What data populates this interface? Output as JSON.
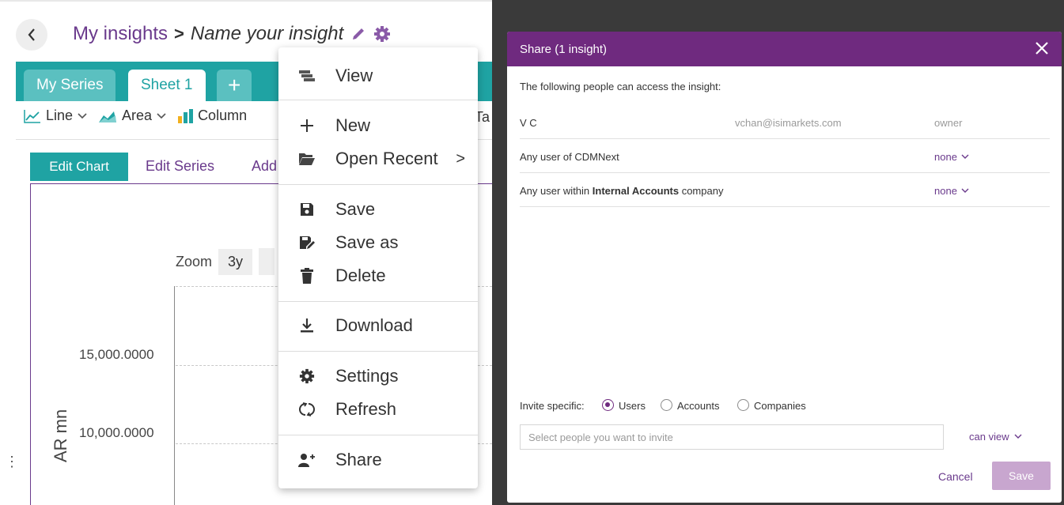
{
  "header": {
    "breadcrumb_root": "My insights",
    "breadcrumb_sep": ">",
    "insight_name": "Name your insight"
  },
  "tabs": [
    {
      "label": "My Series"
    },
    {
      "label": "Sheet 1"
    },
    {
      "label": "+"
    }
  ],
  "chart_types": [
    {
      "label": "Line",
      "icon": "line-chart-icon"
    },
    {
      "label": "Area",
      "icon": "area-chart-icon"
    },
    {
      "label": "Column",
      "icon": "column-chart-icon"
    },
    {
      "label": "Ta"
    }
  ],
  "edit_tabs": {
    "edit_chart": "Edit Chart",
    "edit_series": "Edit Series",
    "add": "Add"
  },
  "chart": {
    "zoom_label": "Zoom",
    "zoom_option": "3y",
    "y_ticks": [
      "15,000.0000",
      "10,000.0000"
    ],
    "y_label": "AR mn"
  },
  "menu": {
    "items": [
      {
        "label": "View",
        "icon": "view-icon"
      },
      {
        "label": "New",
        "icon": "plus-icon"
      },
      {
        "label": "Open Recent",
        "icon": "folder-open-icon",
        "submenu": ">"
      },
      {
        "label": "Save",
        "icon": "save-icon"
      },
      {
        "label": "Save as",
        "icon": "save-as-icon"
      },
      {
        "label": "Delete",
        "icon": "trash-icon"
      },
      {
        "label": "Download",
        "icon": "download-icon"
      },
      {
        "label": "Settings",
        "icon": "gear-icon"
      },
      {
        "label": "Refresh",
        "icon": "refresh-icon"
      },
      {
        "label": "Share",
        "icon": "share-user-icon"
      }
    ]
  },
  "share_dialog": {
    "title": "Share (1 insight)",
    "intro": "The following people can access the insight:",
    "rows": [
      {
        "name": "V C",
        "email": "vchan@isimarkets.com",
        "permission": "owner"
      },
      {
        "name": "Any user of CDMNext",
        "permission": "none"
      },
      {
        "name_pre": "Any user within ",
        "name_bold": "Internal Accounts",
        "name_post": " company",
        "permission": "none"
      }
    ],
    "invite_label": "Invite specific:",
    "invite_options": [
      "Users",
      "Accounts",
      "Companies"
    ],
    "invite_selected": "Users",
    "invite_placeholder": "Select people you want to invite",
    "invite_permission": "can view",
    "cancel_label": "Cancel",
    "save_label": "Save"
  },
  "colors": {
    "teal": "#1fa3a3",
    "purple": "#6f2a7f",
    "link_purple": "#6a3a8c"
  }
}
